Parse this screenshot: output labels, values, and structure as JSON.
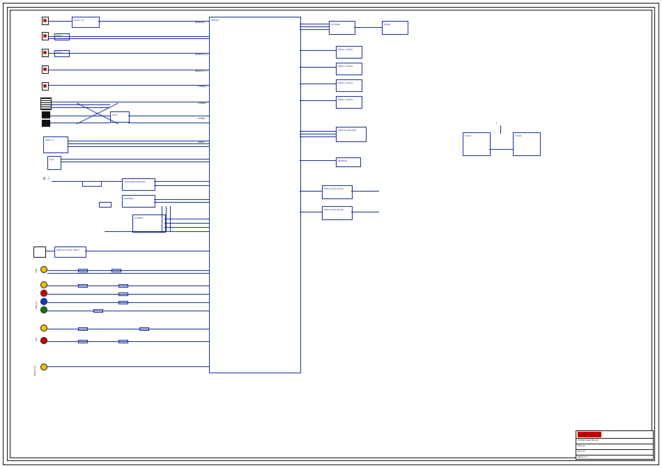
{
  "main_ic": "MT5329",
  "side_blocks": {
    "panel": "PANEL",
    "nt7168a": "NT7168A",
    "ddr3_0": "DDR3_1\\n(2Gbit)",
    "ddr3_1": "DDR3_2\\n(2Gbit)",
    "ddr3_2": "DDR3_3\\n(2Gbit)",
    "ddr3_3": "DDR3_4\\n(2Gbit)",
    "nand": "NAND FLASH\\n2GB",
    "eeprom2c": "EEPROM",
    "nor1": "NOR FLASH\\n(Opt01)",
    "nor2": "NOR FLASH\\n(Opt02)"
  },
  "left_blocks": {
    "scart_in": "SCART_IN",
    "hdmi0": "CON 0",
    "hdmi1": "CON 1",
    "hub": "HCM",
    "edid": "EDID X 2",
    "vga": "VGA",
    "iic_store": "I2C/POWER\\nSENSOR",
    "esd": "ESDM352",
    "if_demo": "IF DEMO",
    "sideav_scart": "SIDE AV\\nSCART_INPUT"
  },
  "right_small": {
    "t_con": "T-CON",
    "t_con2": "T-CON",
    "ant": ""
  },
  "pins_left": [
    "HDMI IN1",
    "HDMI IN 1_0",
    "HDMI IN 1_1",
    "TUNER1",
    "TUNER2",
    "TUNER",
    "AUDIO"
  ],
  "jacks": {
    "usb_lbl": "USB",
    "av_group_lbl": "SIDE AV",
    "hp_lbl": "H/P",
    "spdif_lbl": "SPDIF OUT"
  },
  "title_block": {
    "company": "",
    "title": "MT5329 MAIN BLOCK",
    "size": "A1",
    "drawn": "",
    "rev": "1.0",
    "sheet": "1 / 1",
    "date": ""
  }
}
